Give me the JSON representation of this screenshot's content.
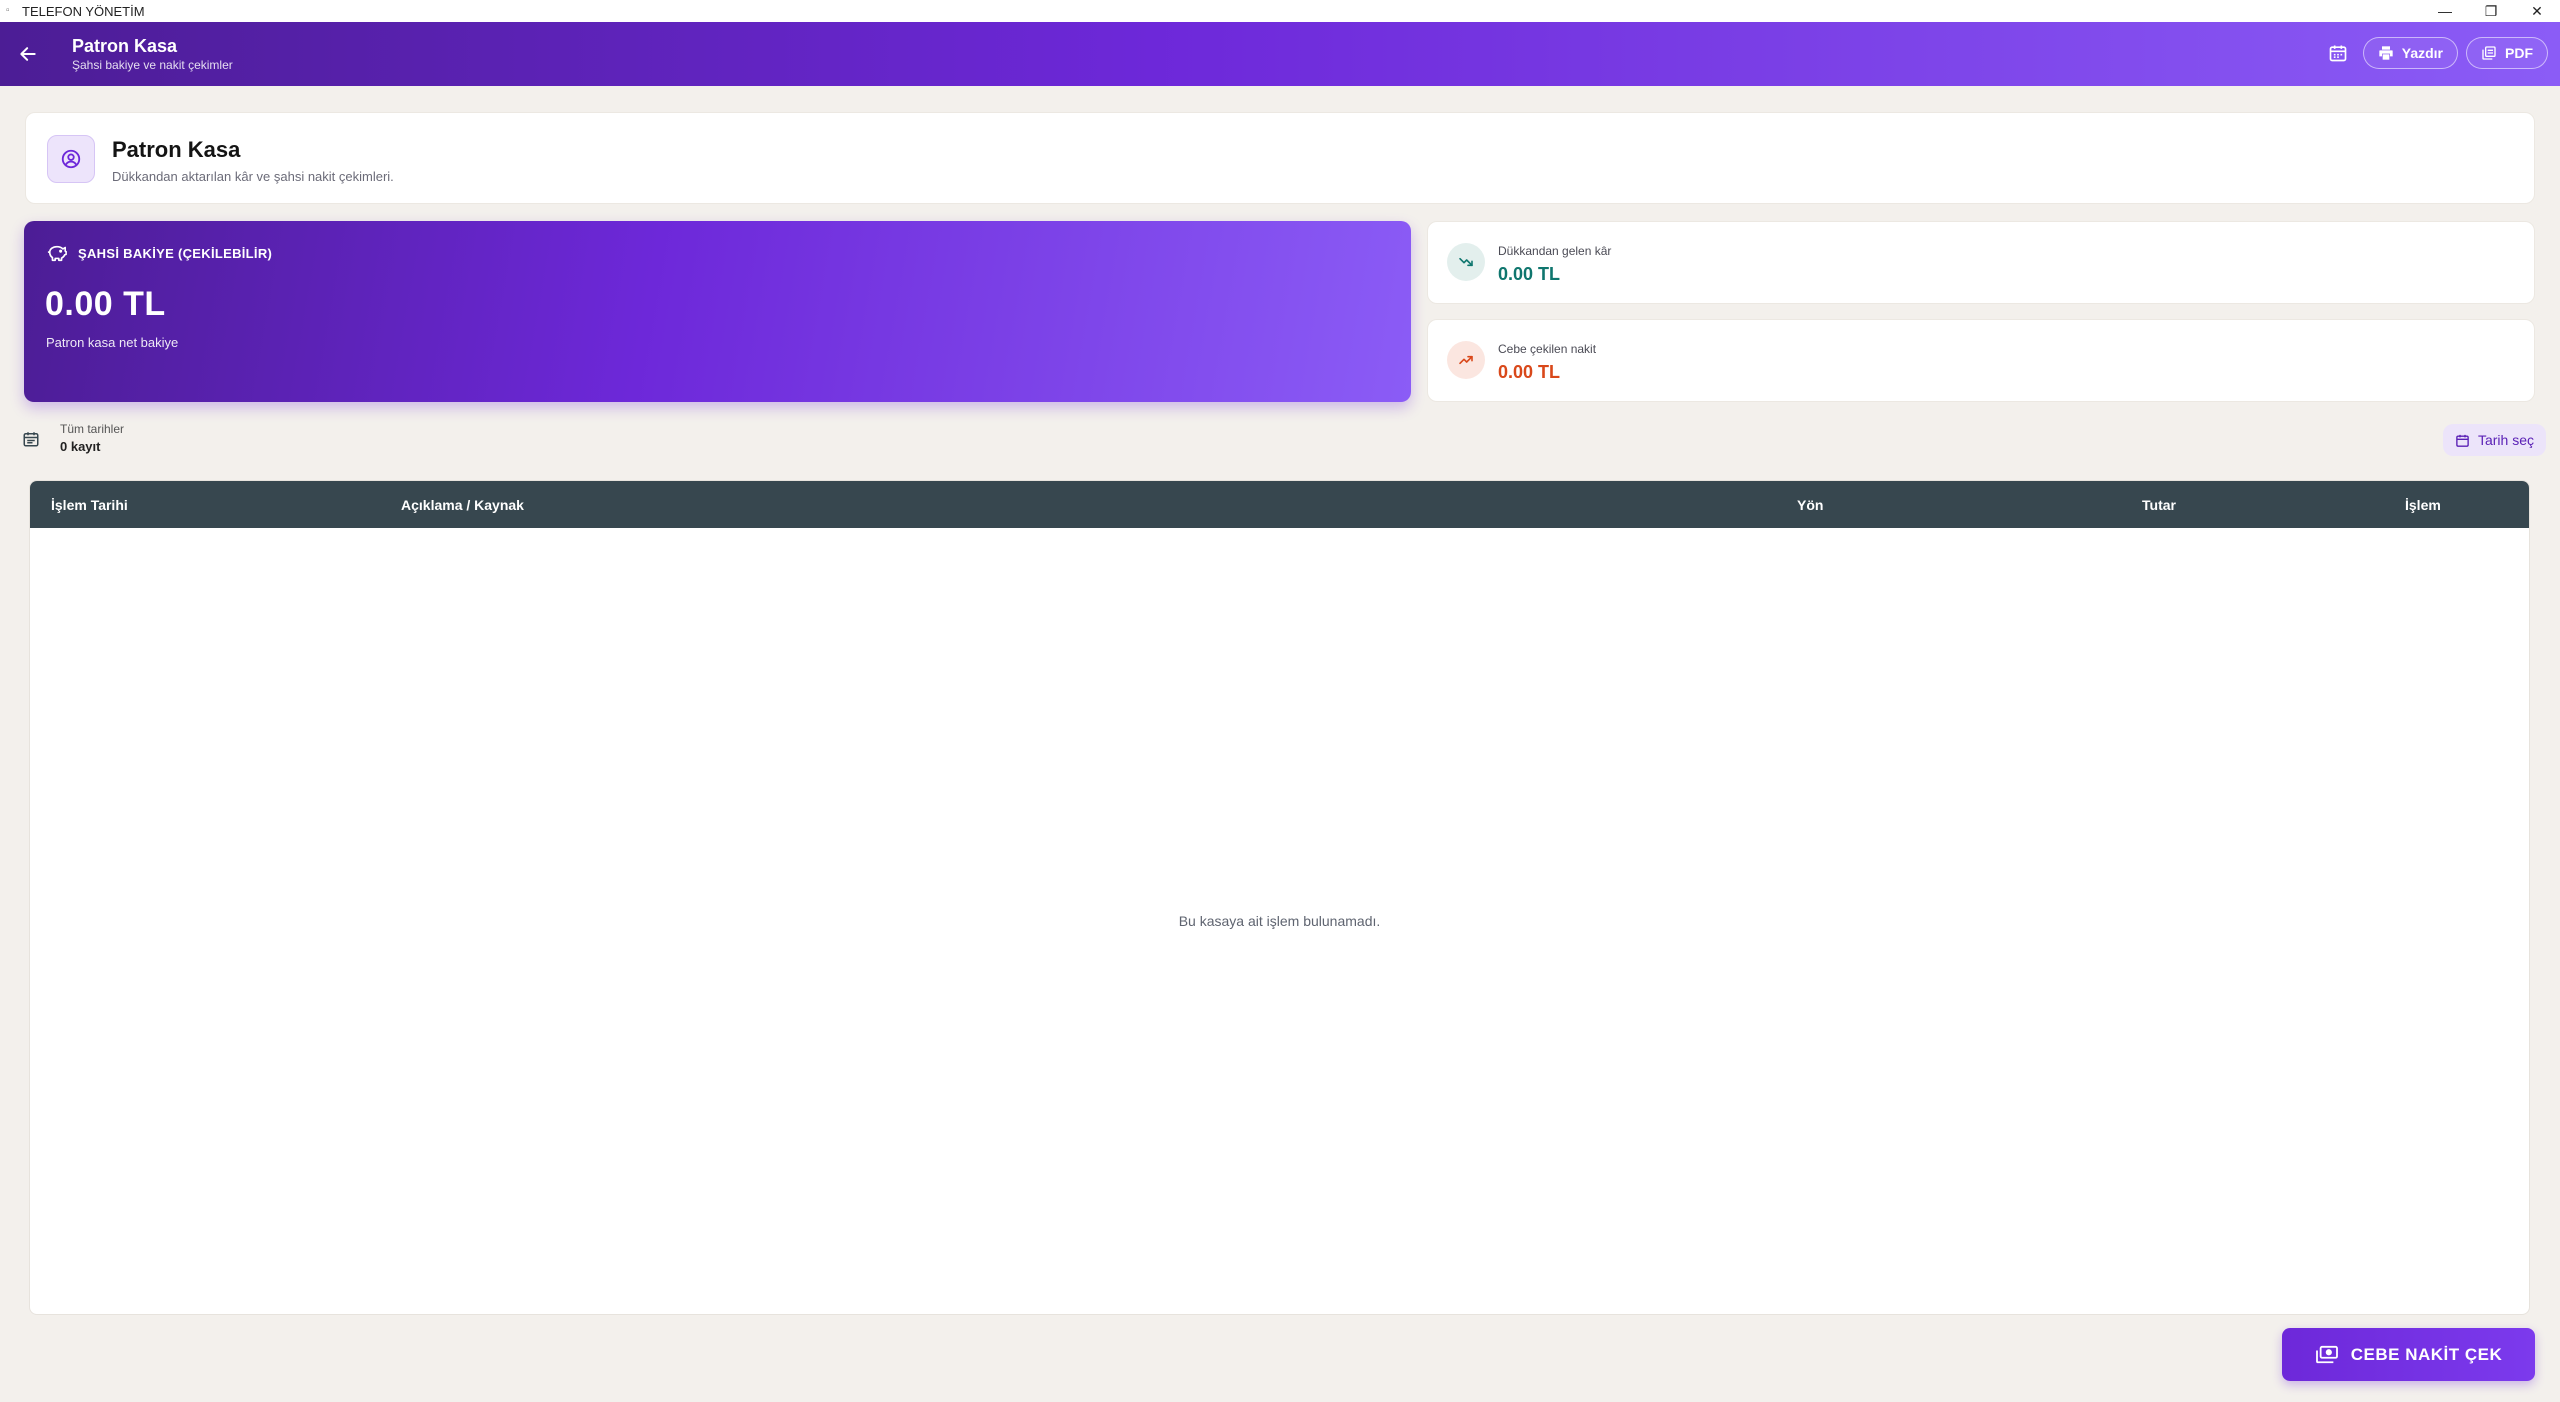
{
  "window": {
    "title": "TELEFON YÖNETİM",
    "controls": [
      "—",
      "❐",
      "✕"
    ]
  },
  "appbar": {
    "title": "Patron Kasa",
    "subtitle": "Şahsi bakiye ve nakit çekimler",
    "print_label": "Yazdır",
    "pdf_label": "PDF"
  },
  "header": {
    "title": "Patron Kasa",
    "subtitle": "Dükkandan aktarılan kâr ve şahsi nakit çekimleri."
  },
  "balance": {
    "label": "ŞAHSİ BAKİYE (ÇEKİLEBİLİR)",
    "amount": "0.00 TL",
    "caption": "Patron kasa net bakiye"
  },
  "stats": [
    {
      "label": "Dükkandan gelen kâr",
      "value": "0.00 TL",
      "icon": "trending-down-icon"
    },
    {
      "label": "Cebe çekilen nakit",
      "value": "0.00 TL",
      "icon": "trending-up-icon"
    }
  ],
  "filter": {
    "range_label": "Tüm tarihler",
    "count_label": "0 kayıt",
    "date_button": "Tarih seç"
  },
  "table": {
    "columns": [
      "İşlem Tarihi",
      "Açıklama / Kaynak",
      "Yön",
      "Tutar",
      "İşlem"
    ],
    "rows": [],
    "empty_message": "Bu kasaya ait işlem bulunamadı."
  },
  "fab": {
    "label": "CEBE NAKİT ÇEK"
  },
  "colors": {
    "accent": "#6d28d9",
    "income": "#0f766e",
    "expense": "#d9481a",
    "table_header": "#37474f"
  }
}
